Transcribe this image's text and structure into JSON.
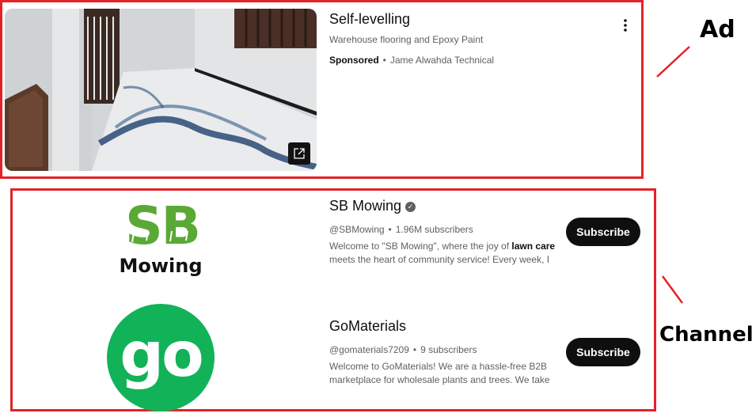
{
  "ad": {
    "title": "Self-levelling",
    "subtitle": "Warehouse flooring and Epoxy Paint",
    "sponsored_label": "Sponsored",
    "separator": "•",
    "advertiser": "Jame Alwahda Technical",
    "menu_icon": "more-vert-icon",
    "external_icon": "open-in-new-icon"
  },
  "annotations": {
    "ad_label": "Ad",
    "channels_label": "Channels",
    "box_color": "#e32227"
  },
  "channels": [
    {
      "name": "SB Mowing",
      "verified": true,
      "handle": "@SBMowing",
      "separator": "•",
      "subscribers": "1.96M subscribers",
      "desc_before": "Welcome to \"SB Mowing\", where the joy of ",
      "desc_bold": "lawn care",
      "desc_after": " meets the heart of community service! Every week, I",
      "subscribe_label": "Subscribe",
      "logo_text_top": "SB",
      "logo_text_bottom": "Mowing",
      "logo_color": "#5aa936"
    },
    {
      "name": "GoMaterials",
      "verified": false,
      "handle": "@gomaterials7209",
      "separator": "•",
      "subscribers": "9 subscribers",
      "desc": "Welcome to GoMaterials! We are a hassle-free B2B marketplace for wholesale plants and trees. We take",
      "subscribe_label": "Subscribe",
      "logo_text": "go",
      "logo_color": "#12b259"
    }
  ]
}
